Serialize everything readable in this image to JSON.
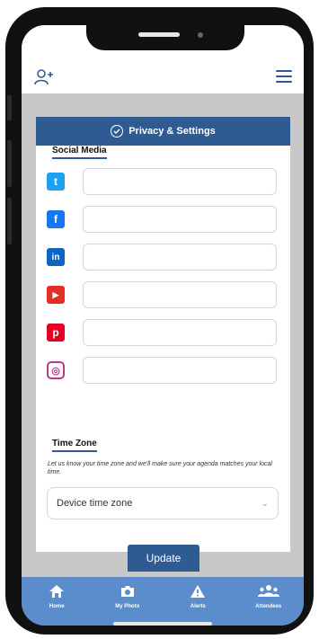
{
  "card": {
    "title": "Privacy & Settings"
  },
  "social_media": {
    "title": "Social Media",
    "platforms": [
      {
        "name": "twitter",
        "icon": "twitter-icon",
        "color": "#1da1f2",
        "glyph": "t",
        "value": ""
      },
      {
        "name": "facebook",
        "icon": "facebook-icon",
        "color": "#1877f2",
        "glyph": "f",
        "value": ""
      },
      {
        "name": "linkedin",
        "icon": "linkedin-icon",
        "color": "#0a66c2",
        "glyph": "in",
        "value": ""
      },
      {
        "name": "youtube",
        "icon": "youtube-icon",
        "color": "#e52d27",
        "glyph": "▶",
        "value": ""
      },
      {
        "name": "pinterest",
        "icon": "pinterest-icon",
        "color": "#e60023",
        "glyph": "p",
        "value": ""
      },
      {
        "name": "instagram",
        "icon": "instagram-icon",
        "color": "#c13584",
        "glyph": "◎",
        "value": ""
      }
    ]
  },
  "time_zone": {
    "title": "Time Zone",
    "help_text": "Let us know your time zone and we'll make sure your agenda matches your local time.",
    "selected": "Device time zone"
  },
  "actions": {
    "update_label": "Update"
  },
  "bottom_nav": [
    {
      "label": "Home",
      "icon": "home-icon"
    },
    {
      "label": "My Photo",
      "icon": "camera-icon"
    },
    {
      "label": "Alerts",
      "icon": "alert-icon"
    },
    {
      "label": "Attendees",
      "icon": "attendees-icon"
    }
  ],
  "colors": {
    "primary": "#2f5b93",
    "nav_background": "#5b8ccc",
    "screen_background": "#c8c8c8"
  }
}
